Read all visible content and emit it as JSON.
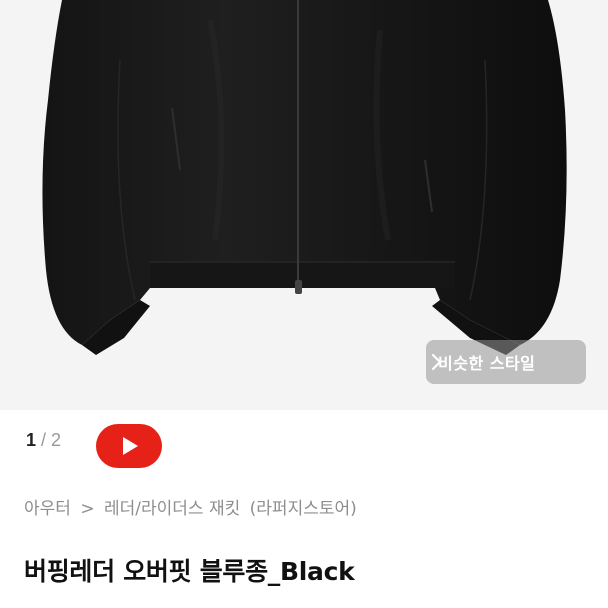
{
  "gallery": {
    "image_alt": "black leather jacket product photo",
    "current": "1",
    "separator": "/",
    "total": "2",
    "similar_style_label": "비슷한 스타일",
    "similar_style_icon": "chevron-right-icon",
    "video_icon": "youtube-play-icon",
    "video_color": "#e62117"
  },
  "breadcrumb": {
    "category": "아우터",
    "separator": ">",
    "subcategory": "레더/라이더스 재킷",
    "store": "(라퍼지스토어)"
  },
  "product": {
    "title": "버핑레더 오버핏 블루종_Black"
  }
}
